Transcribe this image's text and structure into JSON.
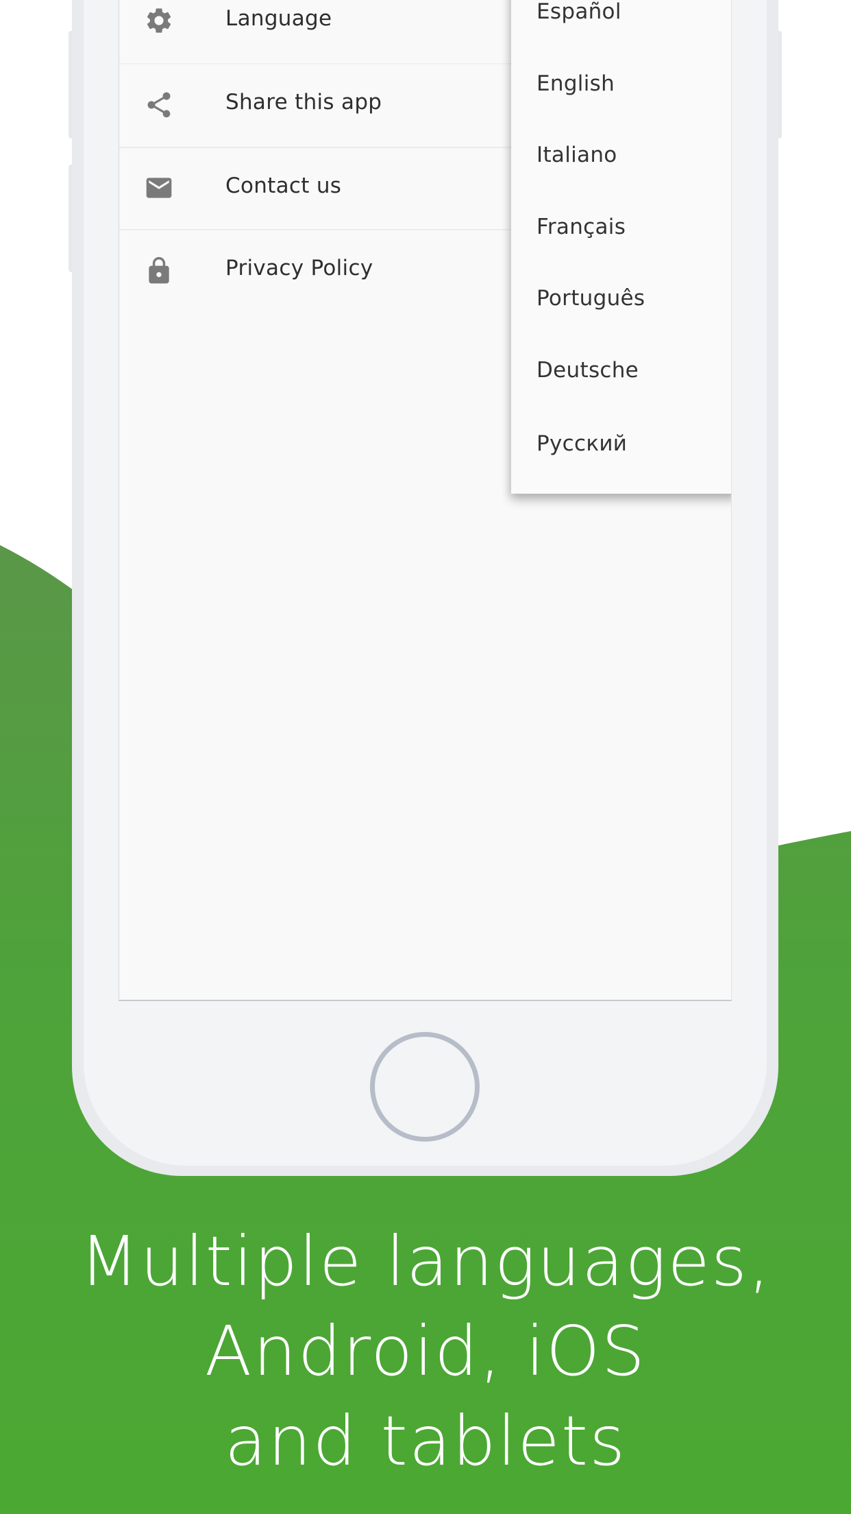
{
  "colors": {
    "brand_green": "#4ba832",
    "brand_green_top": "#5a9748",
    "icon_gray": "#7a7a7a",
    "text_dark": "#2e2e2e"
  },
  "menu": {
    "items": [
      {
        "icon": "gear-icon",
        "label": "Language"
      },
      {
        "icon": "share-icon",
        "label": "Share this app"
      },
      {
        "icon": "mail-icon",
        "label": "Contact us"
      },
      {
        "icon": "lock-icon",
        "label": "Privacy Policy"
      }
    ]
  },
  "language_dropdown": {
    "options": [
      "Español",
      "English",
      "Italiano",
      "Français",
      "Português",
      "Deutsche",
      "Русский"
    ]
  },
  "caption": {
    "lines": [
      "Multiple languages,",
      "Android, iOS",
      "and tablets"
    ]
  }
}
